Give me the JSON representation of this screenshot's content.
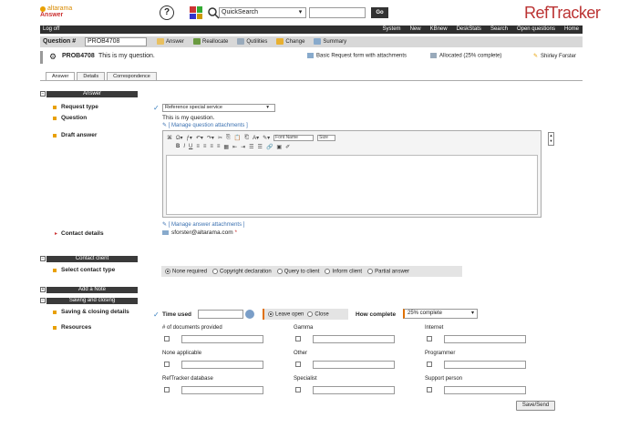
{
  "header": {
    "brand": "altarama",
    "product": "Answer",
    "help_icon": "?",
    "quicksearch_value": "QuickSearch",
    "go_label": "Go",
    "logo_text": "RefTracker"
  },
  "navbar": {
    "logoff": "Log off",
    "items": [
      "System",
      "New",
      "KBnew",
      "DeskStats",
      "Search",
      "Open questions",
      "Home"
    ]
  },
  "question_bar": {
    "label": "Question #",
    "id_value": "PROB4708",
    "actions": [
      "Answer",
      "Reallocate",
      "Qutilities",
      "Change",
      "Summary"
    ]
  },
  "problem": {
    "id": "PROB4708",
    "description": "This is my question.",
    "form": "Basic Request form with attachments",
    "allocation": "Allocated (25% complete)",
    "user": "Shirley Forster"
  },
  "tabs": [
    "Answer",
    "Details",
    "Correspondence"
  ],
  "sections": {
    "answer": "Answer",
    "contact_client": "Contact client",
    "add_note": "Add a Note",
    "saving": "Saving and closing"
  },
  "fields": {
    "request_type": "Request type",
    "question": "Question",
    "draft_answer": "Draft answer",
    "contact_details": "Contact details",
    "select_contact_type": "Select contact type",
    "saving_details": "Saving & closing details",
    "resources": "Resources"
  },
  "request_type_value": "Reference special service",
  "question_text": "This is my question.",
  "question_attach": "[ Manage question attachments ]",
  "answer_attach": "[ Manage answer attachments ]",
  "editor": {
    "font_name": "Font Name",
    "font_size": "Size"
  },
  "contact_email": "sforster@altarama.com",
  "contact_required": "*",
  "contact_types": [
    {
      "label": "None required",
      "selected": true
    },
    {
      "label": "Copyright declaration",
      "selected": false
    },
    {
      "label": "Query to client",
      "selected": false
    },
    {
      "label": "Inform client",
      "selected": false
    },
    {
      "label": "Partial answer",
      "selected": false
    }
  ],
  "saving": {
    "time_used_label": "Time used",
    "leave_open": "Leave open",
    "close": "Close",
    "how_complete_label": "How complete",
    "how_complete_value": "25% complete"
  },
  "resources": [
    "# of documents provided",
    "Gamma",
    "Internet",
    "None applicable",
    "Other",
    "Programmer",
    "RefTracker database",
    "Specialist",
    "Support person"
  ],
  "save_button": "Save/Send",
  "colors": {
    "accent": "#e8a000",
    "nav_bg": "#2f2f2f",
    "logo_red": "#b33333",
    "link_blue": "#3a70b0"
  }
}
